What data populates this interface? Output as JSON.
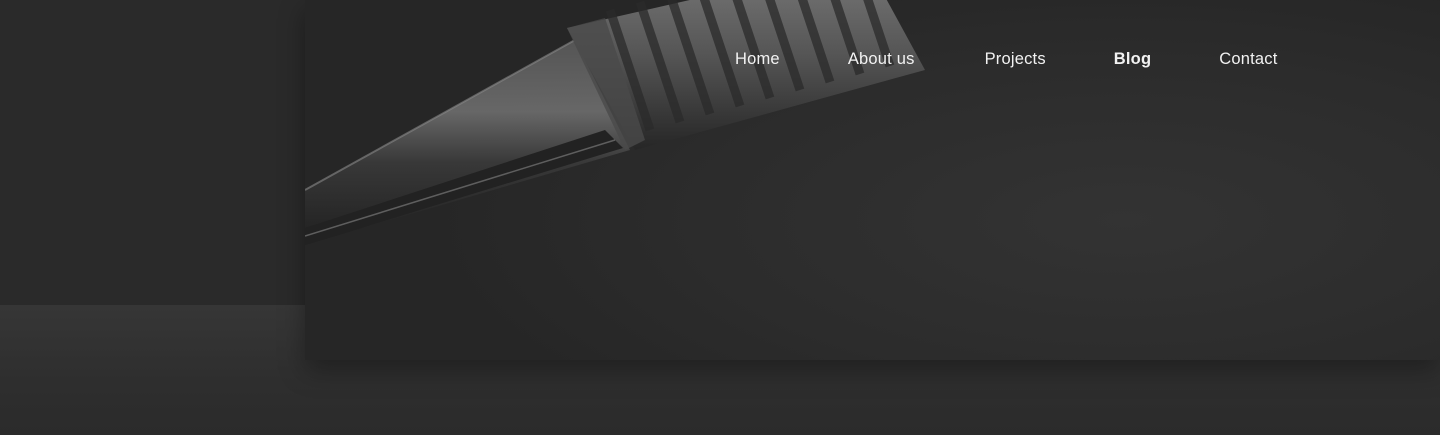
{
  "nav": {
    "items": [
      {
        "label": "Home",
        "active": false
      },
      {
        "label": "About us",
        "active": false
      },
      {
        "label": "Projects",
        "active": false
      },
      {
        "label": "Blog",
        "active": true
      },
      {
        "label": "Contact",
        "active": false
      }
    ]
  },
  "hero": {
    "image": "pen-closeup-photo",
    "tone": "grayscale"
  },
  "colors": {
    "background": "#2b2b2b",
    "nav_text": "#f2f2f2"
  }
}
